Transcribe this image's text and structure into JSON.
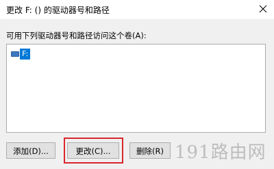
{
  "window": {
    "title": "更改 F: () 的驱动器号和路径"
  },
  "dialog": {
    "instruction": "可用下列驱动器号和路径访问这个卷(A):",
    "list_items": [
      {
        "label": "F:",
        "icon": "drive-icon",
        "selected": true
      }
    ],
    "buttons": {
      "add": "添加(D)...",
      "change": "更改(C)...",
      "delete": "删除(R)"
    }
  },
  "watermark": {
    "text": "191路由网"
  },
  "colors": {
    "selection": "#0078d7",
    "highlight": "#d9262c"
  }
}
